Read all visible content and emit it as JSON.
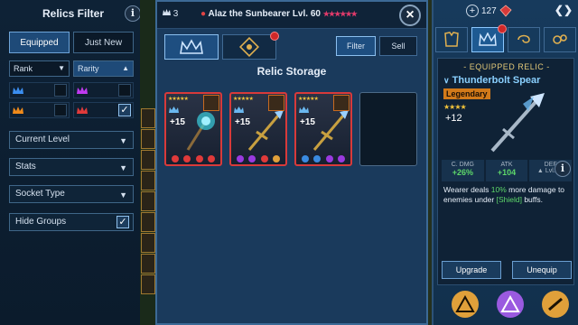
{
  "filter": {
    "title": "Relics Filter",
    "info": "i",
    "tabs": [
      "Equipped",
      "Just New"
    ],
    "rank_label": "Rank",
    "rarity_label": "Rarity",
    "dropdowns": [
      "Current Level",
      "Stats",
      "Socket Type"
    ],
    "hide_groups_label": "Hide Groups",
    "hide_groups_checked": true,
    "rarity_colors": [
      "#3b8ef0",
      "#c03af0",
      "#f08a1a",
      "#e03a3a"
    ],
    "rarity_checked": [
      false,
      false,
      false,
      true
    ]
  },
  "storage": {
    "count": "3",
    "champion": "Alaz the Sunbearer Lvl. 60",
    "filter_button": "Filter",
    "sell_button": "Sell",
    "title": "Relic Storage",
    "relics": [
      {
        "level": "+15",
        "gems": [
          "#e03a3a",
          "#e03a3a",
          "#e03a3a",
          "#e03a3a"
        ]
      },
      {
        "level": "+15",
        "gems": [
          "#9a3ae0",
          "#9a3ae0",
          "#e03a3a",
          "#e0a03a"
        ]
      },
      {
        "level": "+15",
        "gems": [
          "#3a8ae0",
          "#3a8ae0",
          "#9a3ae0",
          "#9a3ae0"
        ]
      }
    ]
  },
  "equipped": {
    "currency_value": "127",
    "plus": "+",
    "header": "EQUIPPED RELIC",
    "name": "Thunderbolt Spear",
    "rarity": "Legendary",
    "level": "+12",
    "stats": [
      {
        "label": "C. DMG",
        "value": "+26%"
      },
      {
        "label": "ATK",
        "value": "+104"
      },
      {
        "label": "DEF",
        "value": "Lvl. 15"
      }
    ],
    "desc_before": "Wearer deals ",
    "desc_pct": "10%",
    "desc_mid": " more damage to enemies under ",
    "desc_shield": "[Shield]",
    "desc_after": " buffs.",
    "upgrade_button": "Upgrade",
    "unequip_button": "Unequip",
    "bottom_icon_colors": [
      "#e0a03a",
      "#9a5ae0",
      "#e0a03a"
    ]
  }
}
